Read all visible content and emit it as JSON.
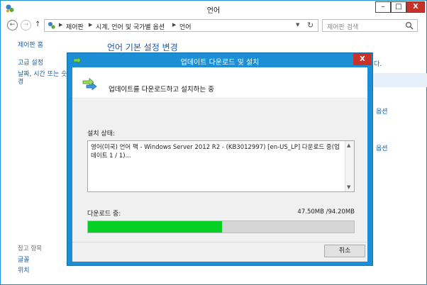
{
  "window": {
    "title": "언어",
    "controls": {
      "minimize": "–",
      "maximize": "□",
      "close": "X"
    }
  },
  "navbar": {
    "back": "←",
    "forward": "→",
    "up": "↑",
    "breadcrumb": [
      "제어판",
      "시계, 언어 및 국가별 옵션",
      "언어"
    ],
    "search_placeholder": "제어판 검색"
  },
  "sidebar": {
    "links": [
      "제어판 홈",
      "고급 설정",
      "날짜, 시간 또는 숫",
      "경"
    ],
    "see_also_heading": "참고 항목",
    "see_also": [
      "글꼴",
      "위치"
    ]
  },
  "main": {
    "heading": "언어 기본 설정 변경",
    "right_fragments": [
      "다.",
      "옵션",
      "옵션"
    ]
  },
  "dialog": {
    "title": "업데이트 다운로드 및 설치",
    "close": "X",
    "header_text": "업데이트를 다운로드하고 설치하는 중",
    "status_label": "설치 상태:",
    "status_text": "영어(미국) 언어 팩 - Windows Server 2012 R2 - (KB3012997) [en-US_LP] 다운로드 중(업데이트 1 / 1)...",
    "download_label": "다운로드 중:",
    "download_size": "47.50MB /94.20MB",
    "progress_fraction": 0.504,
    "cancel_label": "취소"
  },
  "colors": {
    "accent": "#1b8ed6",
    "close_red": "#c7332a",
    "progress_green": "#06d025",
    "link_blue": "#1a5fa8"
  }
}
